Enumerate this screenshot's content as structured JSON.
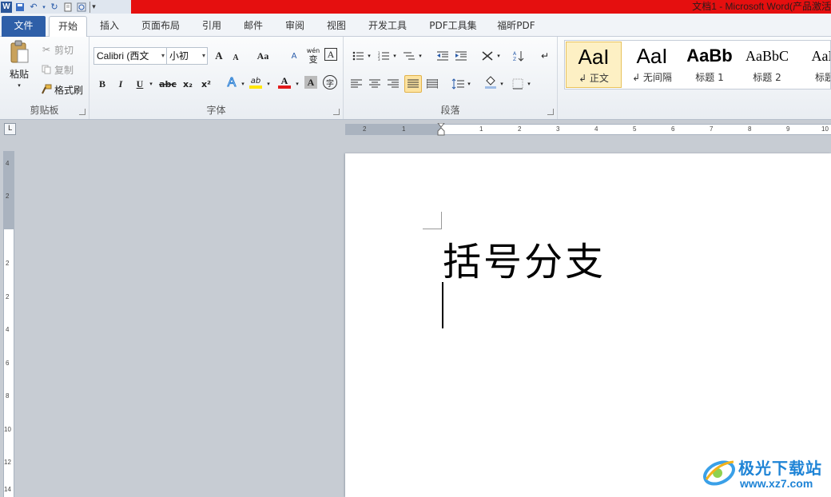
{
  "window": {
    "title": "文档1 - Microsoft Word(产品激活"
  },
  "qat": {
    "word_logo": "W",
    "customize": "▾"
  },
  "tabs": [
    "文件",
    "开始",
    "插入",
    "页面布局",
    "引用",
    "邮件",
    "审阅",
    "视图",
    "开发工具",
    "PDF工具集",
    "福昕PDF"
  ],
  "clipboard": {
    "paste": "粘贴",
    "cut": "剪切",
    "copy": "复制",
    "format_painter": "格式刷",
    "label": "剪贴板"
  },
  "font": {
    "name": "Calibri (西文",
    "size": "小初",
    "grow": "A",
    "shrink": "A",
    "change_case": "Aa",
    "clear_format": "A",
    "pinyin": "wén",
    "pinyin_char": "变",
    "border_char": "A",
    "bold": "B",
    "italic": "I",
    "underline": "U",
    "strike": "abc",
    "subscript": "x₂",
    "superscript": "x²",
    "highlight": "ab",
    "font_color": "A",
    "shading": "A",
    "enclose": "字",
    "label": "字体"
  },
  "paragraph": {
    "label": "段落"
  },
  "styles": [
    {
      "preview": "AaI",
      "name": "↲ 正文"
    },
    {
      "preview": "AaI",
      "name": "↲ 无间隔"
    },
    {
      "preview": "AaBb",
      "name": "标题 1"
    },
    {
      "preview": "AaBbC",
      "name": "标题 2"
    },
    {
      "preview": "AaB",
      "name": "标题"
    }
  ],
  "hruler": [
    "2",
    "1",
    "1",
    "2",
    "3",
    "4",
    "5",
    "6",
    "7",
    "8",
    "9",
    "10"
  ],
  "vruler": [
    "4",
    "2",
    "2",
    "2",
    "4",
    "6",
    "8",
    "10",
    "12",
    "14"
  ],
  "document": {
    "text": "括号分支"
  },
  "watermark": {
    "name": "极光下载站",
    "url": "www.xz7.com"
  },
  "colors": {
    "title_bar": "#e50f0f",
    "file_tab": "#2e5fa8",
    "highlight": "#ffe600",
    "font_color": "#e21b1b",
    "watermark": "#1f84d6"
  }
}
